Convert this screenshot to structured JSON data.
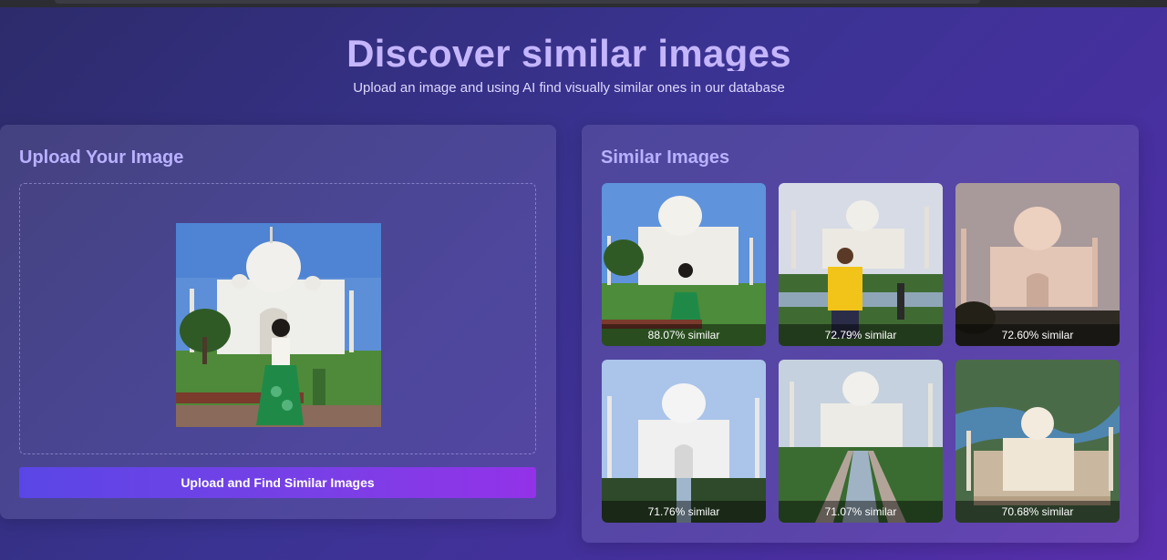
{
  "header": {
    "title": "Discover similar images",
    "subtitle": "Upload an image and using AI find visually similar ones in our database"
  },
  "upload": {
    "heading": "Upload Your Image",
    "button_label": "Upload and Find Similar Images"
  },
  "results": {
    "heading": "Similar Images",
    "items": [
      {
        "label": "88.07% similar"
      },
      {
        "label": "72.79% similar"
      },
      {
        "label": "72.60% similar"
      },
      {
        "label": "71.76% similar"
      },
      {
        "label": "71.07% similar"
      },
      {
        "label": "70.68% similar"
      }
    ]
  },
  "colors": {
    "accent_start": "#5a46e6",
    "accent_end": "#9332e8",
    "heading": "#c4b5fd"
  }
}
